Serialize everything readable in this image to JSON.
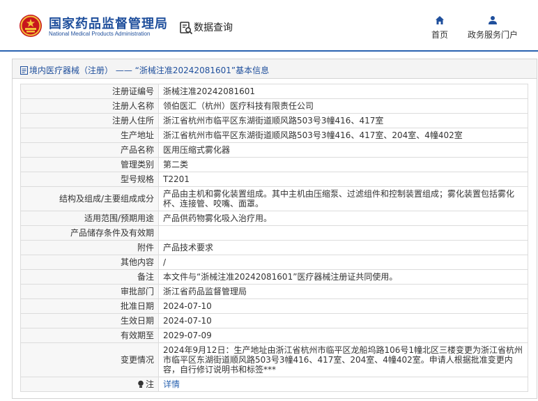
{
  "header": {
    "brand_cn": "国家药品监督管理局",
    "brand_en": "National Medical Products Administration",
    "data_query": "数据查询",
    "nav_home": "首页",
    "nav_service": "政务服务门户",
    "accent_color": "#1f4f9c"
  },
  "panel": {
    "crumb_link": "境内医疗器械（注册）",
    "crumb_sep": "——",
    "crumb_current": "“浙械注准20242081601”基本信息"
  },
  "rows": [
    {
      "label": "注册证编号",
      "value": "浙械注准20242081601"
    },
    {
      "label": "注册人名称",
      "value": "领伯医汇（杭州）医疗科技有限责任公司"
    },
    {
      "label": "注册人住所",
      "value": "浙江省杭州市临平区东湖街道顺风路503号3幢416、417室"
    },
    {
      "label": "生产地址",
      "value": "浙江省杭州市临平区东湖街道顺风路503号3幢416、417室、204室、4幢402室"
    },
    {
      "label": "产品名称",
      "value": "医用压缩式雾化器"
    },
    {
      "label": "管理类别",
      "value": "第二类"
    },
    {
      "label": "型号规格",
      "value": "T2201"
    },
    {
      "label": "结构及组成/主要组成成分",
      "value": "产品由主机和雾化装置组成。其中主机由压缩泵、过滤组件和控制装置组成；雾化装置包括雾化杯、连接管、咬嘴、面罩。"
    },
    {
      "label": "适用范围/预期用途",
      "value": "产品供药物雾化吸入治疗用。"
    },
    {
      "label": "产品储存条件及有效期",
      "value": ""
    },
    {
      "label": "附件",
      "value": "产品技术要求"
    },
    {
      "label": "其他内容",
      "value": "/"
    },
    {
      "label": "备注",
      "value": "本文件与“浙械注准20242081601”医疗器械注册证共同使用。"
    },
    {
      "label": "审批部门",
      "value": "浙江省药品监督管理局"
    },
    {
      "label": "批准日期",
      "value": "2024-07-10"
    },
    {
      "label": "生效日期",
      "value": "2024-07-10"
    },
    {
      "label": "有效期至",
      "value": "2029-07-09"
    },
    {
      "label": "变更情况",
      "value": "2024年9月12日：生产地址由浙江省杭州市临平区龙船坞路106号1幢北区三楼变更为浙江省杭州市临平区东湖街道顺风路503号3幢416、417室、204室、4幢402室。申请人根据批准变更内容，自行修订说明书和标签***"
    }
  ],
  "note": {
    "label": "注",
    "link": "详情"
  }
}
